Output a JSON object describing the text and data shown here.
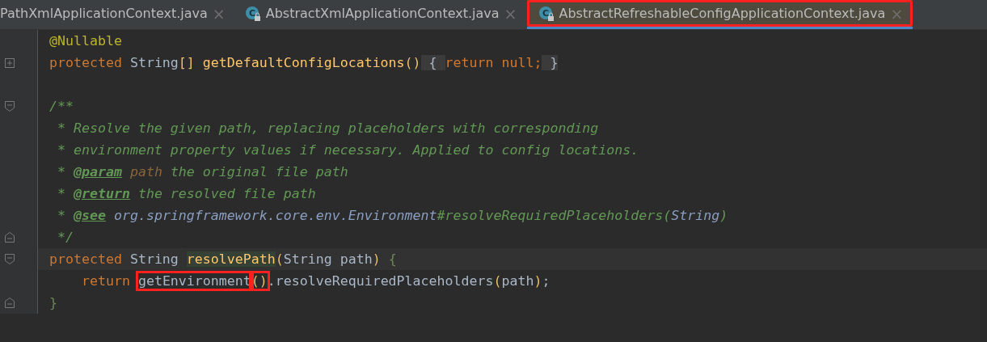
{
  "tabs": [
    {
      "label": "PathXmlApplicationContext.java",
      "selected": false,
      "marked": false
    },
    {
      "label": "AbstractXmlApplicationContext.java",
      "icon": "C",
      "selected": false,
      "marked": false
    },
    {
      "label": "AbstractRefreshableConfigApplicationContext.java",
      "icon": "C",
      "selected": true,
      "marked": true
    }
  ],
  "close_glyph": "×",
  "lines": [
    {
      "tokens": [
        {
          "kind": "annotation",
          "text": "@Nullable"
        }
      ]
    },
    {
      "kind": "fold_collapsed",
      "tokens": [
        {
          "kind": "keyword",
          "text": "protected"
        },
        {
          "kind": "plain",
          "text": " String"
        },
        {
          "kind": "paren",
          "text": "[]"
        },
        {
          "kind": "method",
          "text": " getDefaultConfigLocations"
        },
        {
          "kind": "paren",
          "text": "()"
        },
        {
          "kind": "folded",
          "text": " { "
        },
        {
          "kind": "keyword",
          "text": "return null;"
        },
        {
          "kind": "folded",
          "text": " }"
        }
      ]
    },
    {
      "kind": "blank"
    },
    {
      "kind": "fold_start",
      "tokens": [
        {
          "kind": "comment",
          "text": "/**"
        }
      ]
    },
    {
      "tokens": [
        {
          "kind": "comment",
          "text": " * Resolve the given path, replacing placeholders with corresponding"
        }
      ]
    },
    {
      "tokens": [
        {
          "kind": "comment",
          "text": " * environment property values if necessary. Applied to config locations."
        }
      ]
    },
    {
      "tokens": [
        {
          "kind": "comment",
          "text": " * "
        },
        {
          "kind": "doctag",
          "text": "@param"
        },
        {
          "kind": "docparam",
          "text": " path"
        },
        {
          "kind": "comment",
          "text": " the original file path"
        }
      ]
    },
    {
      "tokens": [
        {
          "kind": "comment",
          "text": " * "
        },
        {
          "kind": "doctag",
          "text": "@return"
        },
        {
          "kind": "comment",
          "text": " the resolved file path"
        }
      ]
    },
    {
      "tokens": [
        {
          "kind": "comment",
          "text": " * "
        },
        {
          "kind": "doctag",
          "text": "@see"
        },
        {
          "kind": "doclink",
          "text": " org.springframework.core.env.Environment"
        },
        {
          "kind": "comment",
          "text": "#resolveRequiredPlaceholders"
        },
        {
          "kind": "comment",
          "text": "("
        },
        {
          "kind": "doclink",
          "text": "String"
        },
        {
          "kind": "comment",
          "text": ")"
        }
      ]
    },
    {
      "kind": "fold_end",
      "tokens": [
        {
          "kind": "comment",
          "text": " */"
        }
      ]
    },
    {
      "kind": "fold_start",
      "current": true,
      "tokens": [
        {
          "kind": "keyword",
          "text": "protected"
        },
        {
          "kind": "plain",
          "text": " String "
        },
        {
          "kind": "method",
          "text": "resolvePath",
          "highlighted": true
        },
        {
          "kind": "paren",
          "text": "("
        },
        {
          "kind": "plain",
          "text": "String path"
        },
        {
          "kind": "paren",
          "text": ")"
        },
        {
          "kind": "brace",
          "text": " {"
        }
      ]
    },
    {
      "tokens": [
        {
          "kind": "keyword",
          "text": "    return "
        },
        {
          "kind": "plain",
          "text": "getEnvironment",
          "marked": true
        },
        {
          "kind": "paren",
          "text": "()",
          "marked": true
        },
        {
          "kind": "plain",
          "text": ".resolveRequiredPlaceholders"
        },
        {
          "kind": "paren",
          "text": "("
        },
        {
          "kind": "plain",
          "text": "path"
        },
        {
          "kind": "paren",
          "text": ")"
        },
        {
          "kind": "plain",
          "text": ";"
        }
      ]
    },
    {
      "kind": "fold_end",
      "tokens": [
        {
          "kind": "brace",
          "text": "}"
        }
      ]
    }
  ]
}
